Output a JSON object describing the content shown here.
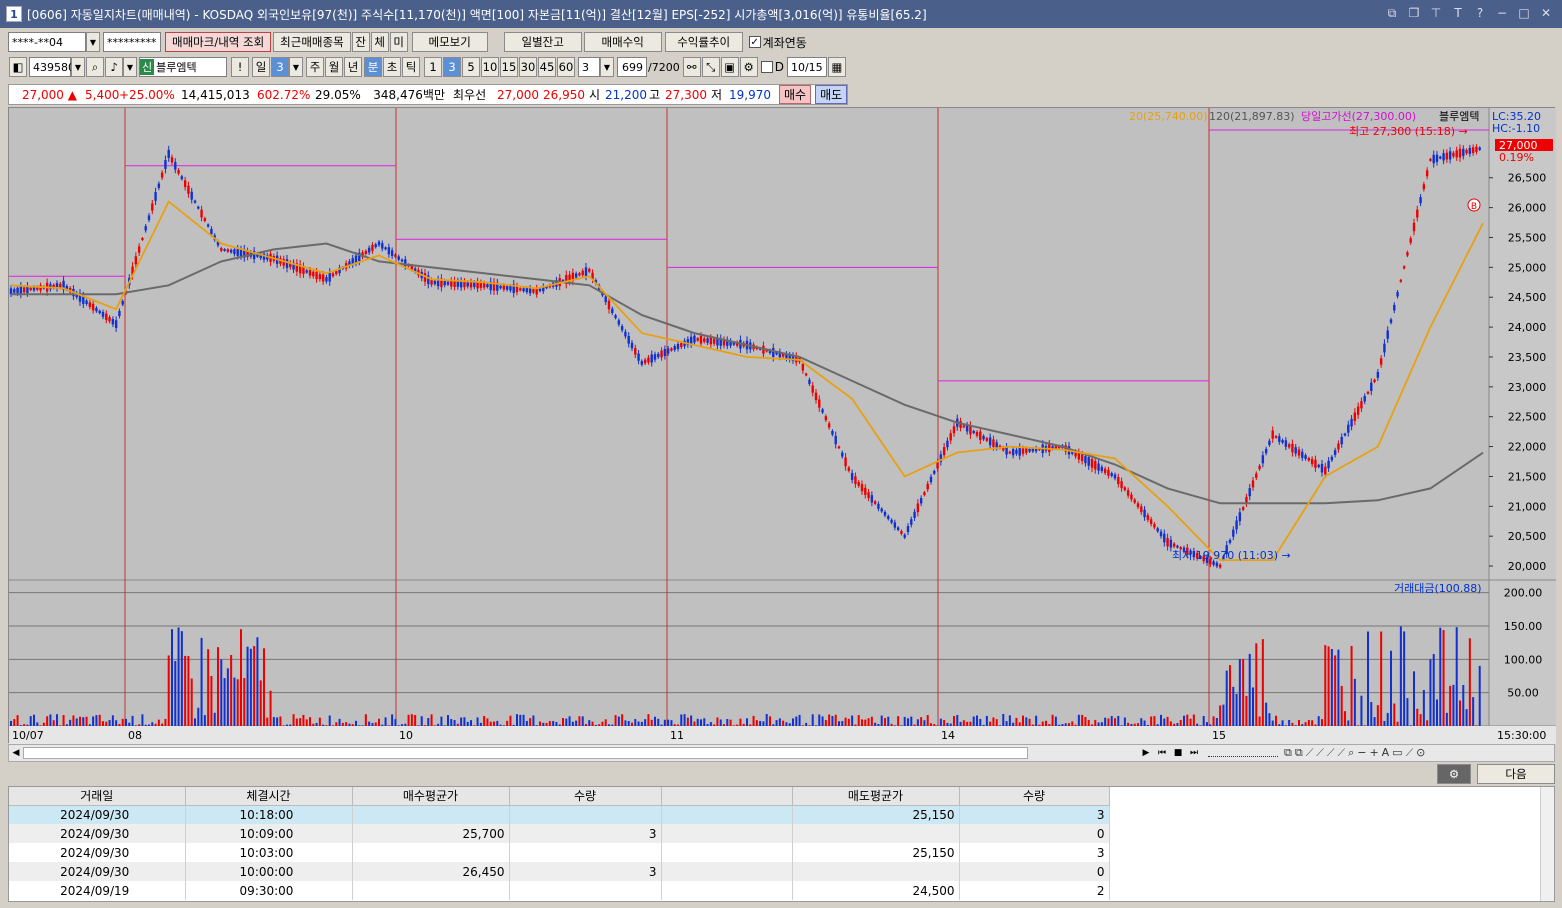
{
  "window": {
    "icon_label": "1",
    "title": "[0606] 자동일지차트(매매내역) - KOSDAQ 외국인보유[97(천)] 주식수[11,170(천)] 액면[100] 자본금[11(억)] 결산[12월] EPS[-252] 시가총액[3,016(억)] 유통비율[65.2]"
  },
  "toolbar1": {
    "account": "****-**04",
    "password": "*********",
    "btn_markview": "매매마크/내역 조회",
    "btn_recent": "최근매매종목",
    "btn_jan": "잔",
    "btn_che": "체",
    "btn_mi": "미",
    "btn_memo": "메모보기",
    "btn_daily": "일별잔고",
    "btn_profit": "매매수익",
    "btn_return": "수익률추이",
    "chk_account_link": "계좌연동"
  },
  "toolbar2": {
    "code": "439580",
    "sin": "신",
    "stock_name": "블루엠텍",
    "excl": "!",
    "period_il": "일",
    "period_num": "3",
    "period_ju": "주",
    "period_wol": "월",
    "period_nyeon": "년",
    "period_bun": "분",
    "period_cho": "초",
    "period_tik": "틱",
    "mins": [
      "1",
      "3",
      "5",
      "10",
      "15",
      "30",
      "45",
      "60"
    ],
    "min_sel": "3",
    "count": "699",
    "count_total": "/7200",
    "chk_d": "D",
    "date": "10/15"
  },
  "infobar": {
    "price": "27,000",
    "change": "5,400",
    "change_pct": "+25.00%",
    "volume": "14,415,013",
    "vol_ratio": "602.72%",
    "turnover": "29.05%",
    "amount": "348,476백만",
    "best_label": "최우선",
    "best_ask": "27,000",
    "best_bid": "26,950",
    "open_label": "시",
    "open": "21,200",
    "high_label": "고",
    "high": "27,300",
    "low_label": "저",
    "low": "19,970",
    "buy_btn": "매수",
    "sell_btn": "매도"
  },
  "chart_labels": {
    "ma20": "20(25,740.00)",
    "ma120": "120(21,897.83)",
    "day_high_line": "당일고가선(27,300.00)",
    "stock_legend": "블루엠텍",
    "lc": "LC:35.20",
    "hc": "HC:-1.10",
    "max_label": "최고 27,300 (15:18)",
    "min_label": "최저 19,970 (11:03)",
    "last_price": "27,000",
    "last_pct": "0.19%",
    "b_marker": "B",
    "vol_legend": "거래대금(100.88)",
    "date_labels": [
      "10/07",
      "08",
      "10",
      "11",
      "14",
      "15"
    ],
    "time_label": "15:30:00",
    "price_ticks": [
      "26,500",
      "26,000",
      "25,500",
      "25,000",
      "24,500",
      "24,000",
      "23,500",
      "23,000",
      "22,500",
      "22,000",
      "21,500",
      "21,000",
      "20,500",
      "20,000"
    ],
    "vol_ticks": [
      "200.00",
      "150.00",
      "100.00",
      "50.00"
    ]
  },
  "chart_data": {
    "type": "line",
    "title": "",
    "ylim": [
      19800,
      27500
    ],
    "sessions": [
      "10/07",
      "10/08",
      "10/10",
      "10/11",
      "10/14",
      "10/15"
    ],
    "series": [
      {
        "name": "블루엠텍",
        "values": [
          24600,
          24700,
          24050,
          26900,
          25300,
          25150,
          24800,
          25400,
          24750,
          24700,
          24600,
          24950,
          23400,
          23800,
          23700,
          23450,
          21500,
          20500,
          22400,
          21900,
          22000,
          21500,
          20400,
          20000,
          22200,
          21600,
          23200,
          26800,
          27000
        ]
      },
      {
        "name": "20",
        "values": [
          24700,
          24650,
          24300,
          26100,
          25400,
          25150,
          24900,
          25200,
          24800,
          24750,
          24650,
          24850,
          23900,
          23700,
          23500,
          23450,
          22800,
          21500,
          21900,
          22000,
          21950,
          21800,
          21000,
          20100,
          20100,
          21500,
          22000,
          24000,
          25740
        ]
      },
      {
        "name": "120",
        "values": [
          24550,
          24550,
          24550,
          24700,
          25100,
          25300,
          25400,
          25100,
          25000,
          24900,
          24800,
          24700,
          24200,
          23900,
          23700,
          23500,
          23100,
          22700,
          22400,
          22200,
          22000,
          21700,
          21300,
          21050,
          21050,
          21050,
          21100,
          21300,
          21898
        ]
      }
    ],
    "volume_ylim": [
      0,
      210
    ],
    "volume_ylabel": "거래대금"
  },
  "nav": {
    "settings_btn": "⚙",
    "next_btn": "다음"
  },
  "table": {
    "headers": [
      "거래일",
      "체결시간",
      "매수평균가",
      "수량",
      "",
      "매도평균가",
      "수량"
    ],
    "rows": [
      [
        "2024/09/30",
        "10:18:00",
        "",
        "",
        "",
        "25,150",
        "3"
      ],
      [
        "2024/09/30",
        "10:09:00",
        "25,700",
        "3",
        "",
        "",
        "0"
      ],
      [
        "2024/09/30",
        "10:03:00",
        "",
        "",
        "",
        "25,150",
        "3"
      ],
      [
        "2024/09/30",
        "10:00:00",
        "26,450",
        "3",
        "",
        "",
        "0"
      ],
      [
        "2024/09/19",
        "09:30:00",
        "",
        "",
        "",
        "24,500",
        "2"
      ]
    ]
  }
}
